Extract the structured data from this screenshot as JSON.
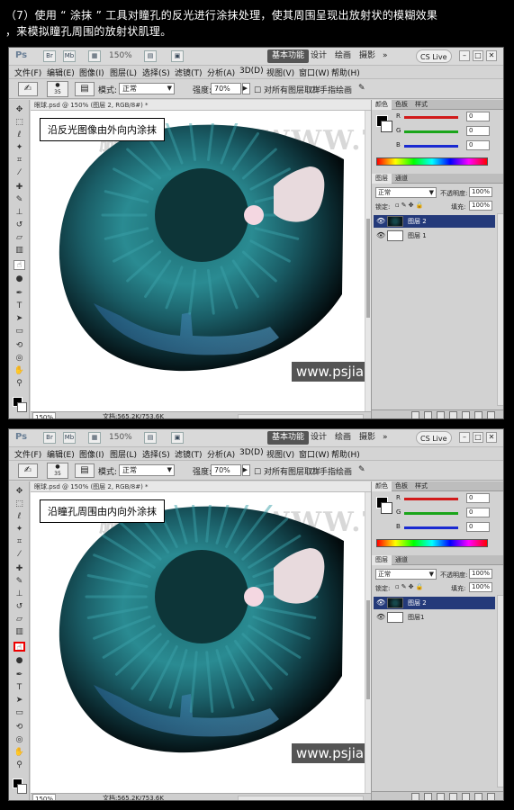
{
  "caption": {
    "line1": "（7）使用 “ 涂抹 ” 工具对瞳孔的反光进行涂抹处理，使其周围呈现出放射状的模糊效果",
    "line2": "，来模拟瞳孔周围的放射状肌理。"
  },
  "app": {
    "logo": "Ps",
    "zoom": "150%",
    "workspaces": [
      "基本功能",
      "设计",
      "绘画",
      "摄影"
    ],
    "workspace_more": "»",
    "cs_live": "CS Live",
    "window_buttons": [
      "–",
      "□",
      "✕"
    ]
  },
  "menu": [
    "文件(F)",
    "编辑(E)",
    "图像(I)",
    "图层(L)",
    "选择(S)",
    "滤镜(T)",
    "分析(A)",
    "3D(D)",
    "视图(V)",
    "窗口(W)",
    "帮助(H)"
  ],
  "options": {
    "brush_size": "35",
    "mode_label": "模式:",
    "mode_value": "正常",
    "strength_label": "强度:",
    "strength_value": "70%",
    "sample_all": "对所有图层取样",
    "finger_paint": "手指绘画"
  },
  "document": {
    "tab_title": "眼球.psd @ 150% (图层 2, RGB/8#) *",
    "watermark": "鵬 龍 視 覺 WWW.TLVI.NET",
    "site_label": "www.psjia.com",
    "zoom": "150%",
    "doc_size": "文档:565.2K/753.6K"
  },
  "panels": {
    "color_tabs": [
      "颜色",
      "色板",
      "样式"
    ],
    "channels": [
      {
        "label": "R",
        "value": "0",
        "color": "#d11a1a"
      },
      {
        "label": "G",
        "value": "0",
        "color": "#1aa51a"
      },
      {
        "label": "B",
        "value": "0",
        "color": "#1a2ad1"
      }
    ],
    "layer_tabs": [
      "图层",
      "通道"
    ],
    "blend_mode": "正常",
    "opacity_label": "不透明度:",
    "opacity_value": "100%",
    "lock_label": "锁定:",
    "fill_label": "填充:",
    "fill_value": "100%",
    "layers": [
      {
        "name": "图层 2",
        "selected": true
      },
      {
        "name": "图层 1",
        "selected": false
      }
    ]
  },
  "screens": [
    {
      "note": "沿反光图像由外向内涂抹",
      "layer1_name": "图层 1",
      "highlight_tool": false
    },
    {
      "note": "沿瞳孔周围由内向外涂抹",
      "layer1_name": "图层1",
      "highlight_tool": true
    }
  ]
}
